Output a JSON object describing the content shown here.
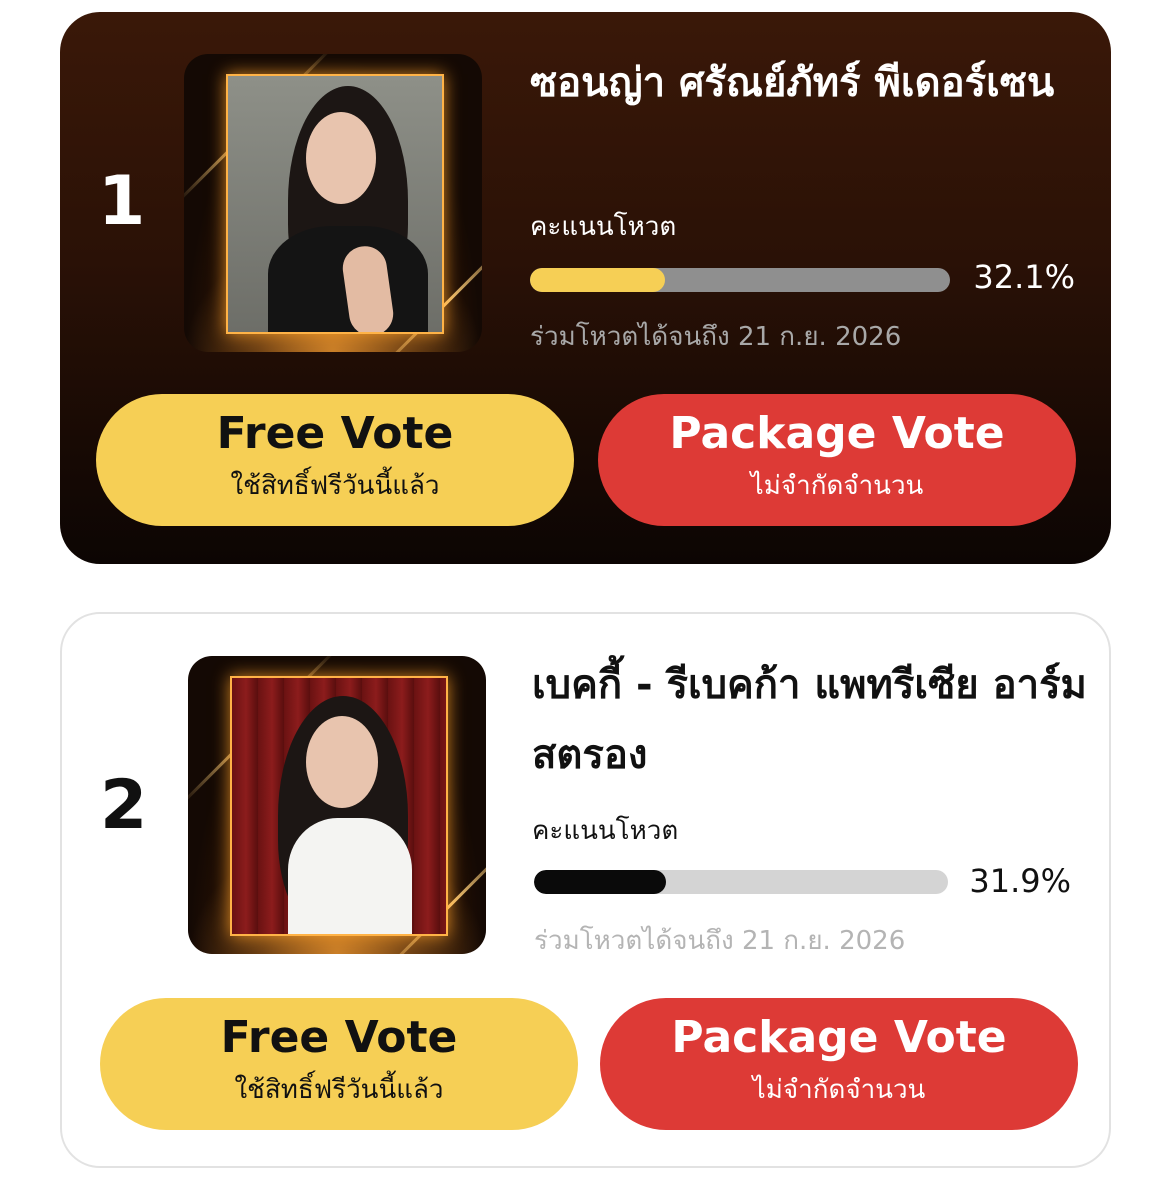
{
  "candidates": [
    {
      "rank": "1",
      "name": "ซอนญ่า ศรัณย์ภัทร์ พีเดอร์เซน",
      "vote_label": "คะแนนโหวต",
      "percent_text": "32.1%",
      "percent_value": 32.1,
      "deadline": "ร่วมโหวตได้จนถึง 21 ก.ย. 2026",
      "free_vote": {
        "title": "Free Vote",
        "subtitle": "ใช้สิทธิ์ฟรีวันนี้แล้ว"
      },
      "package_vote": {
        "title": "Package Vote",
        "subtitle": "ไม่จำกัดจำนวน"
      },
      "bar_color": "#f6cf55"
    },
    {
      "rank": "2",
      "name": "เบคกี้ - รีเบคก้า แพทรีเซีย อาร์มสตรอง",
      "vote_label": "คะแนนโหวต",
      "percent_text": "31.9%",
      "percent_value": 31.9,
      "deadline": "ร่วมโหวตได้จนถึง 21 ก.ย. 2026",
      "free_vote": {
        "title": "Free Vote",
        "subtitle": "ใช้สิทธิ์ฟรีวันนี้แล้ว"
      },
      "package_vote": {
        "title": "Package Vote",
        "subtitle": "ไม่จำกัดจำนวน"
      },
      "bar_color": "#0a0a0a"
    }
  ],
  "colors": {
    "free_button": "#f6cf55",
    "package_button": "#dd3a36",
    "dark_card": "#2a1106"
  }
}
